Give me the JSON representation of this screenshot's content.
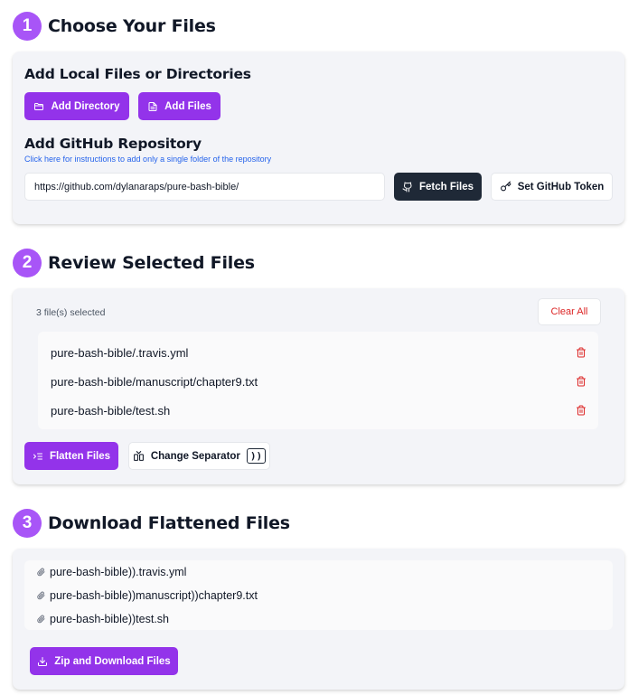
{
  "step1": {
    "number": "1",
    "title": "Choose Your Files",
    "local_title": "Add Local Files or Directories",
    "add_directory_label": "Add Directory",
    "add_files_label": "Add Files",
    "github_title": "Add GitHub Repository",
    "github_instructions_link": "Click here for instructions to add only a single folder of the repository",
    "repo_url_value": "https://github.com/dylanaraps/pure-bash-bible/",
    "fetch_files_label": "Fetch Files",
    "set_token_label": "Set GitHub Token"
  },
  "step2": {
    "number": "2",
    "title": "Review Selected Files",
    "selected_count": "3 file(s) selected",
    "clear_all_label": "Clear All",
    "files": [
      "pure-bash-bible/.travis.yml",
      "pure-bash-bible/manuscript/chapter9.txt",
      "pure-bash-bible/test.sh"
    ],
    "flatten_label": "Flatten Files",
    "change_separator_label": "Change Separator",
    "separator_value": "))"
  },
  "step3": {
    "number": "3",
    "title": "Download Flattened Files",
    "flattened_files": [
      "pure-bash-bible)).travis.yml",
      "pure-bash-bible))manuscript))chapter9.txt",
      "pure-bash-bible))test.sh"
    ],
    "zip_download_label": "Zip and Download Files"
  },
  "colors": {
    "accent": "#9333ea",
    "step_badge": "#a855f7",
    "dark_button": "#1f2937",
    "danger": "#dc2626",
    "link": "#2563eb"
  },
  "icons": {
    "add_directory": "folder-icon",
    "add_files": "file-icon",
    "fetch_files": "github-icon",
    "set_token": "key-icon",
    "delete": "trash-icon",
    "flatten": "list-indent-icon",
    "change_separator": "split-icon",
    "flattened_file": "paperclip-icon",
    "download": "download-icon"
  }
}
